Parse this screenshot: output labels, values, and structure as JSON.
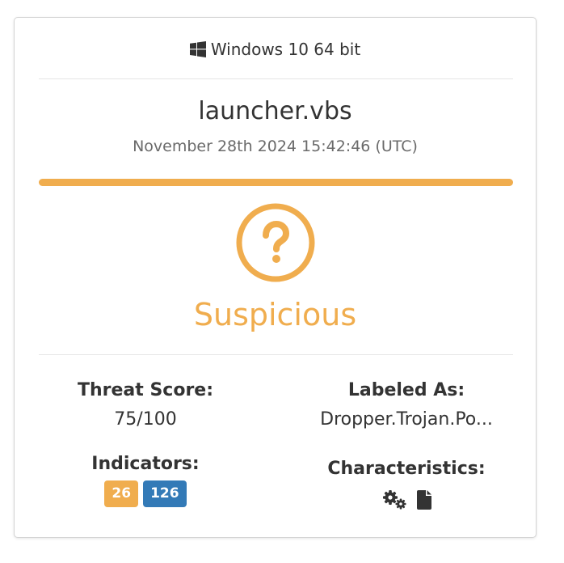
{
  "header": {
    "os_icon": "windows-icon",
    "os_label": "Windows 10 64 bit"
  },
  "file": {
    "name": "launcher.vbs",
    "timestamp": "November 28th 2024 15:42:46 (UTC)"
  },
  "verdict": {
    "icon": "question-circle-icon",
    "label": "Suspicious",
    "color": "#f0ad4e"
  },
  "threat_score": {
    "title": "Threat Score:",
    "value": "75/100"
  },
  "labeled_as": {
    "title": "Labeled As:",
    "value": "Dropper.Trojan.Po..."
  },
  "indicators": {
    "title": "Indicators:",
    "badges": [
      {
        "value": "26",
        "color": "#f0ad4e"
      },
      {
        "value": "126",
        "color": "#337ab7"
      }
    ]
  },
  "characteristics": {
    "title": "Characteristics:",
    "icons": [
      "gears-icon",
      "file-icon"
    ]
  }
}
